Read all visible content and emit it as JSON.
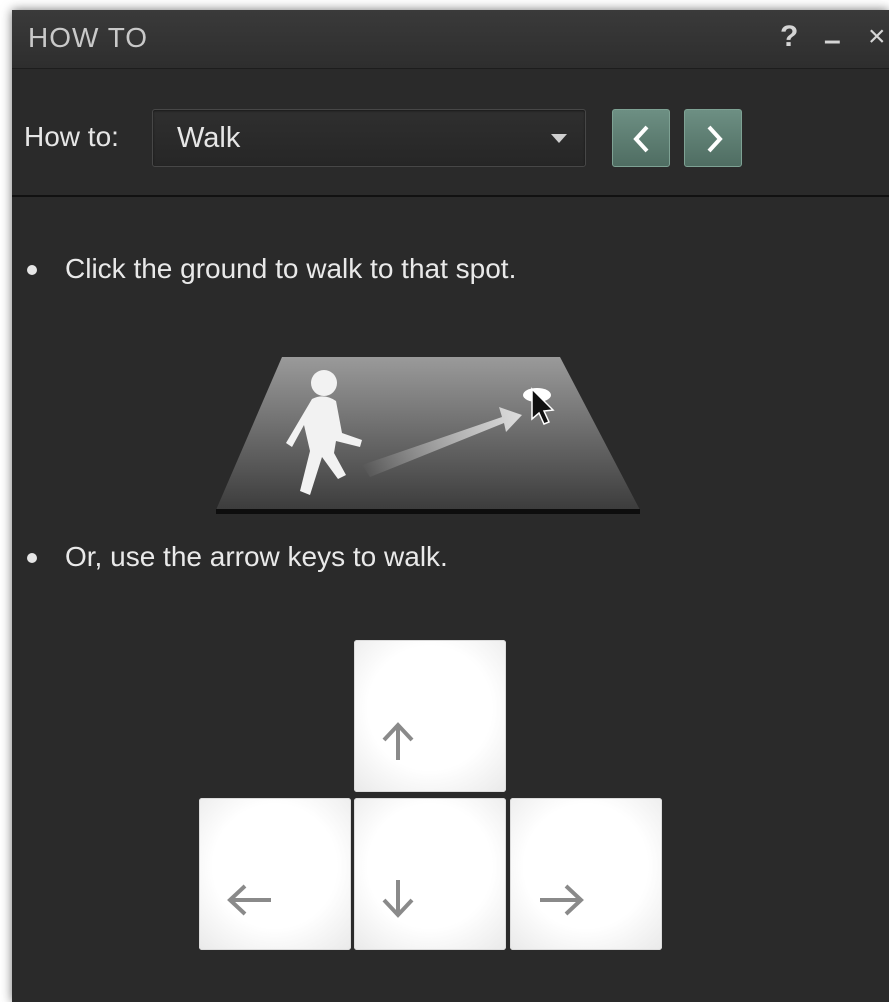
{
  "window": {
    "title": "HOW TO",
    "help_label": "?",
    "minimize_label": "–",
    "close_label": "×"
  },
  "toolbar": {
    "label": "How to:",
    "selected": "Walk",
    "prev_icon": "chevron-left-icon",
    "next_icon": "chevron-right-icon",
    "nav_color": "#5b7b6f"
  },
  "content": {
    "bullets": [
      "Click the ground to walk to that spot.",
      "Or, use the arrow keys to walk."
    ]
  },
  "keys": [
    {
      "name": "up",
      "icon": "arrow-up-icon"
    },
    {
      "name": "left",
      "icon": "arrow-left-icon"
    },
    {
      "name": "down",
      "icon": "arrow-down-icon"
    },
    {
      "name": "right",
      "icon": "arrow-right-icon"
    }
  ],
  "colors": {
    "background": "#2a2a2a",
    "text": "#e9e9e9",
    "key_face": "#ffffff"
  }
}
